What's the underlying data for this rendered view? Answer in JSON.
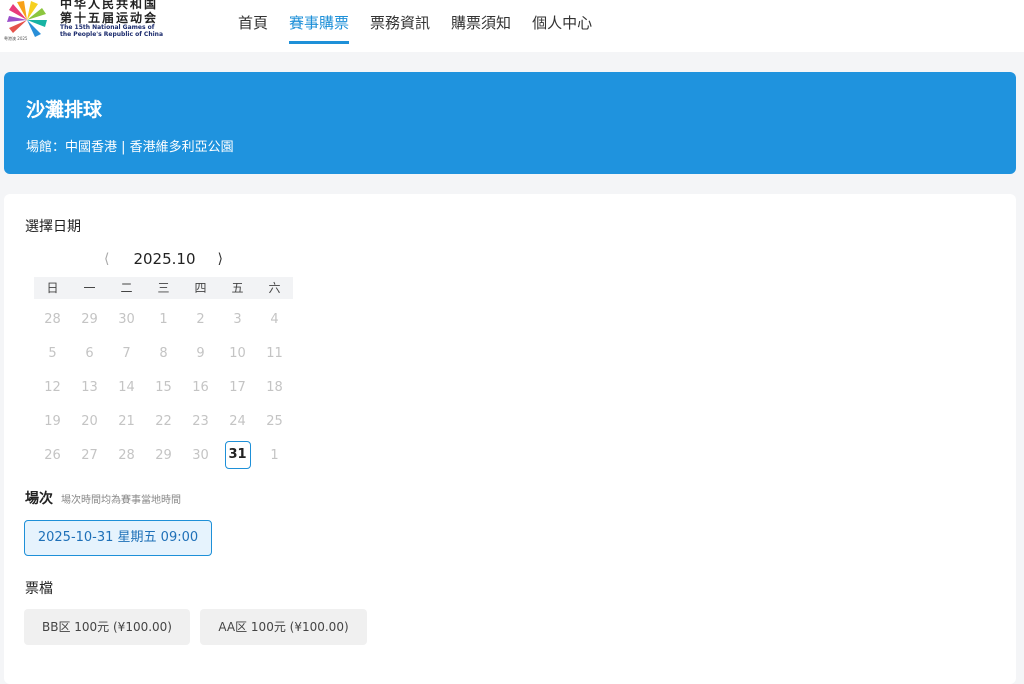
{
  "header": {
    "logo": {
      "cn_line1": "中华人民共和国",
      "cn_line2": "第十五届运动会",
      "en_line1": "The 15th National Games of",
      "en_line2": "the People's Republic of China",
      "sub": "粤港澳 2025"
    },
    "nav": [
      {
        "label": "首頁",
        "active": false
      },
      {
        "label": "賽事購票",
        "active": true
      },
      {
        "label": "票務資訊",
        "active": false
      },
      {
        "label": "購票須知",
        "active": false
      },
      {
        "label": "個人中心",
        "active": false
      }
    ]
  },
  "banner": {
    "title": "沙灘排球",
    "venue": "場館：中國香港 | 香港維多利亞公園",
    "color": "#1f93de"
  },
  "date_section": {
    "label": "選擇日期",
    "month": "2025.10",
    "prev_icon": "chevron-left-icon",
    "next_icon": "chevron-right-icon",
    "weekdays": [
      "日",
      "一",
      "二",
      "三",
      "四",
      "五",
      "六"
    ],
    "weeks": [
      [
        "28",
        "29",
        "30",
        "1",
        "2",
        "3",
        "4"
      ],
      [
        "5",
        "6",
        "7",
        "8",
        "9",
        "10",
        "11"
      ],
      [
        "12",
        "13",
        "14",
        "15",
        "16",
        "17",
        "18"
      ],
      [
        "19",
        "20",
        "21",
        "22",
        "23",
        "24",
        "25"
      ],
      [
        "26",
        "27",
        "28",
        "29",
        "30",
        "31",
        "1"
      ]
    ],
    "selected_day": "31"
  },
  "session_section": {
    "label": "場次",
    "note": "場次時間均為賽事當地時間",
    "session": "2025-10-31 星期五 09:00"
  },
  "tier_section": {
    "label": "票檔",
    "tiers": [
      {
        "label": "BB区 100元 (¥100.00)"
      },
      {
        "label": "AA区 100元 (¥100.00)"
      }
    ]
  },
  "accent_color": "#1e90d8"
}
